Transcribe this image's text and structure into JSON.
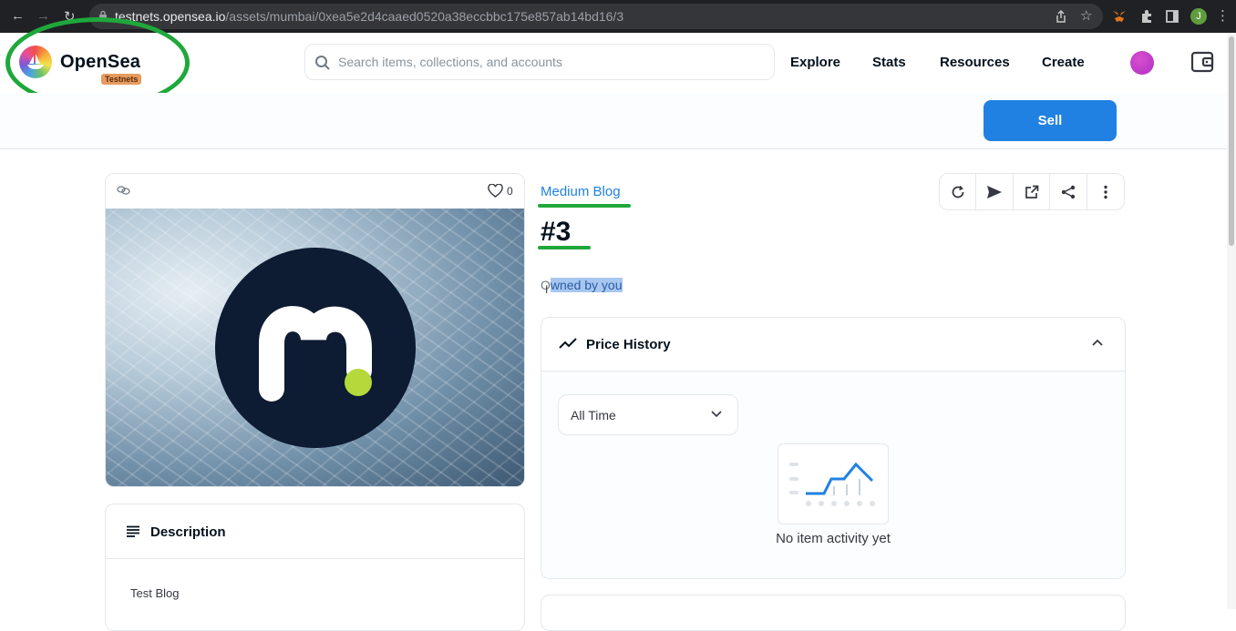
{
  "browser": {
    "url_host": "testnets.opensea.io",
    "url_path": "/assets/mumbai/0xea5e2d4caaed0520a38eccbbc175e857ab14bd16/3",
    "profile_initial": "J"
  },
  "header": {
    "brand": "OpenSea",
    "badge": "Testnets",
    "search_placeholder": "Search items, collections, and accounts",
    "nav": {
      "explore": "Explore",
      "stats": "Stats",
      "resources": "Resources",
      "create": "Create"
    }
  },
  "sell_label": "Sell",
  "asset": {
    "favorites": "0",
    "collection": "Medium Blog",
    "title": "#3",
    "owner_prefix": "O",
    "owner_selected": "wned by you"
  },
  "description": {
    "title": "Description",
    "text": "Test Blog"
  },
  "price_history": {
    "title": "Price History",
    "range_selected": "All Time",
    "empty_text": "No item activity yet"
  },
  "colors": {
    "accent": "#2081e2",
    "highlight_annotation": "#1fa83a",
    "text_primary": "#04111d"
  }
}
